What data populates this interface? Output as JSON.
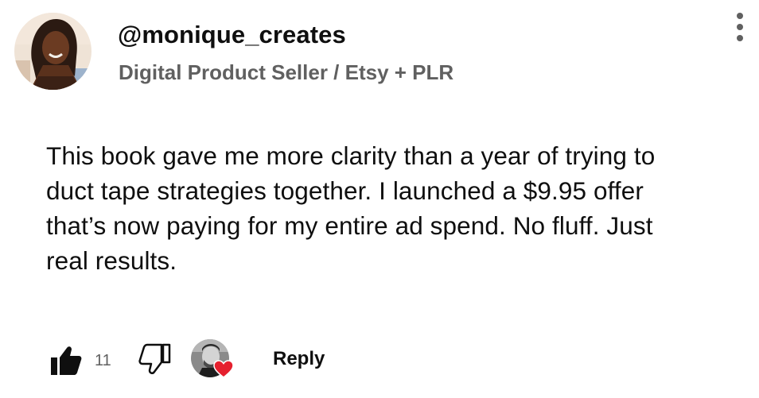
{
  "comment": {
    "username": "@monique_creates",
    "subtitle": "Digital Product Seller / Etsy + PLR",
    "text": "This book gave me more clarity than a year of trying to duct tape strategies together. I launched a $9.95 offer that’s now paying for my entire ad spend. No fluff. Just real results.",
    "avatar_icon": "user-avatar-photo",
    "menu_icon": "more-vert-icon"
  },
  "actions": {
    "like_icon": "thumbs-up-icon",
    "like_count": "11",
    "dislike_icon": "thumbs-down-icon",
    "creator_heart_icon": "creator-heart-icon",
    "reply_label": "Reply"
  },
  "colors": {
    "text_primary": "#0f0f0f",
    "text_secondary": "#606060",
    "heart": "#e5202e",
    "background": "#ffffff"
  }
}
